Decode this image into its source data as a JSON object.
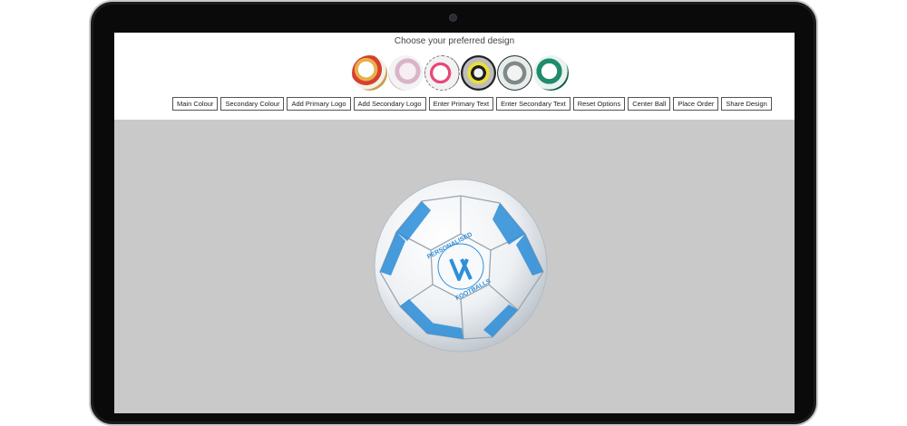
{
  "configurator": {
    "heading": "Choose your preferred design",
    "designs": [
      {
        "name": "red-gold"
      },
      {
        "name": "pink-lilac"
      },
      {
        "name": "pink-purple",
        "selected": true
      },
      {
        "name": "black-yellow"
      },
      {
        "name": "grey-silver"
      },
      {
        "name": "green"
      }
    ],
    "toolbar": {
      "main_colour": "Main Colour",
      "secondary_colour": "Secondary Colour",
      "add_primary_logo": "Add Primary Logo",
      "add_secondary_logo": "Add Secondary Logo",
      "enter_primary_text": "Enter Primary Text",
      "enter_secondary_text": "Enter Secondary Text",
      "reset_options": "Reset Options",
      "center_ball": "Center Ball",
      "place_order": "Place Order",
      "share_design": "Share Design"
    },
    "ball": {
      "logo_text_top": "PERSONALISED",
      "logo_text_bottom": "FOOTBALLS",
      "accent_color": "#2f8fd8"
    },
    "colors": {
      "viewer_background": "#c9c9c9",
      "bezel": "#0a0a0a"
    }
  }
}
